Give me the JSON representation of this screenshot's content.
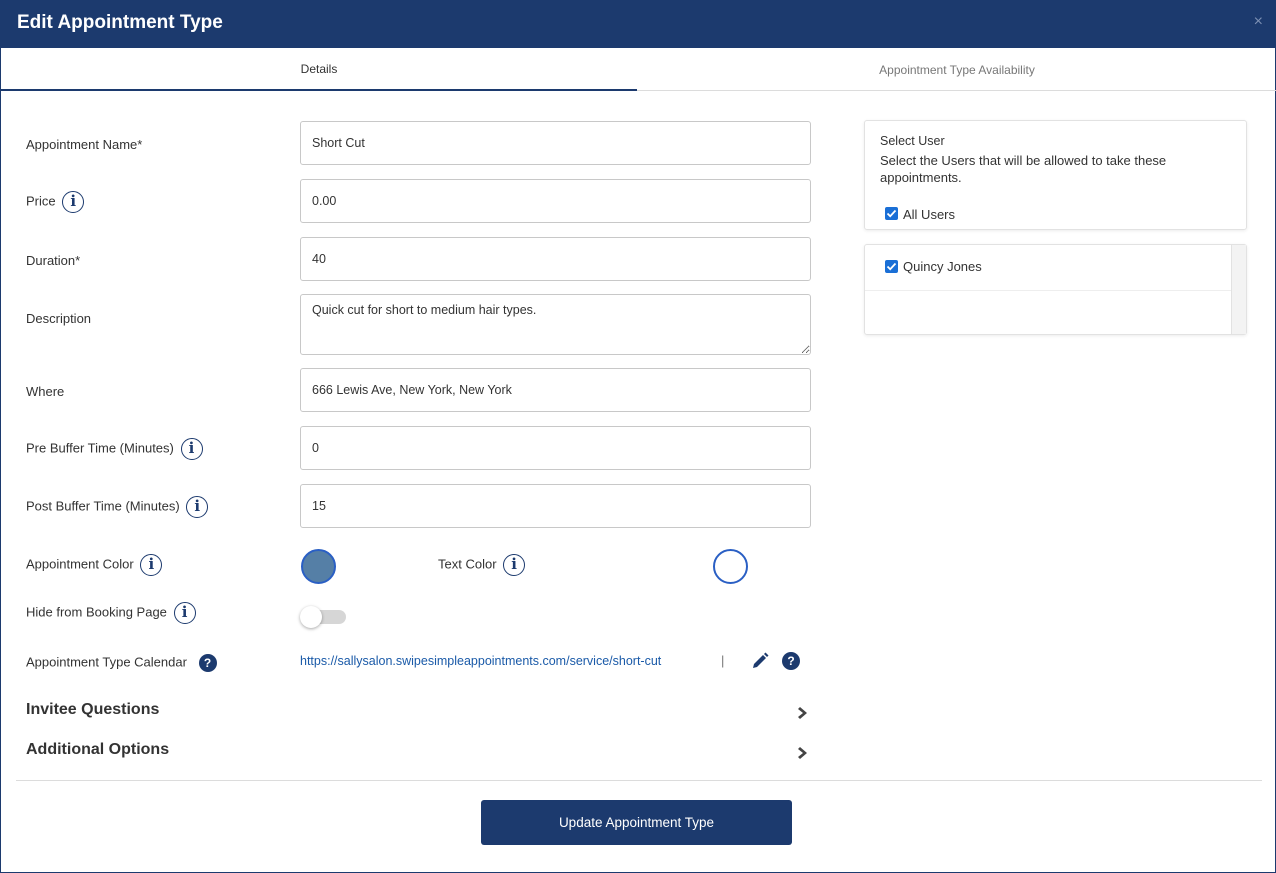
{
  "header": {
    "title": "Edit Appointment Type",
    "close_label": "×"
  },
  "tabs": [
    {
      "label": "Details",
      "active": true
    },
    {
      "label": "Appointment Type Availability",
      "active": false
    }
  ],
  "form": {
    "appointment_name": {
      "label": "Appointment Name*",
      "value": "Short Cut"
    },
    "price": {
      "label": "Price",
      "value": "0.00"
    },
    "duration": {
      "label": "Duration*",
      "value": "40"
    },
    "description": {
      "label": "Description",
      "value": "Quick cut for short to medium hair types."
    },
    "where": {
      "label": "Where",
      "value": "666 Lewis Ave, New York, New York"
    },
    "pre_buffer": {
      "label": "Pre Buffer Time (Minutes)",
      "value": "0"
    },
    "post_buffer": {
      "label": "Post Buffer Time (Minutes)",
      "value": "15"
    },
    "appointment_color": {
      "label": "Appointment Color",
      "color": "#557fa6"
    },
    "text_color": {
      "label": "Text Color",
      "color": "#ffffff"
    },
    "hide_from_booking": {
      "label": "Hide from Booking Page",
      "enabled": false
    },
    "calendar": {
      "label": "Appointment Type Calendar",
      "url": "https://sallysalon.swipesimpleappointments.com/service/short-cut",
      "separator": "|"
    }
  },
  "sections": {
    "invitee_questions": "Invitee Questions",
    "additional_options": "Additional Options"
  },
  "icons": {
    "info": "i",
    "help": "?"
  },
  "footer": {
    "update_label": "Update Appointment Type"
  },
  "user_select": {
    "title": "Select User",
    "description": "Select the Users that will be allowed to take these appointments.",
    "all_users": {
      "label": "All Users",
      "checked": true
    },
    "users": [
      {
        "label": "Quincy Jones",
        "checked": true
      }
    ]
  },
  "colors": {
    "brand": "#1c3a6e",
    "link": "#1a5aa8",
    "checkbox": "#1a6fd6"
  }
}
